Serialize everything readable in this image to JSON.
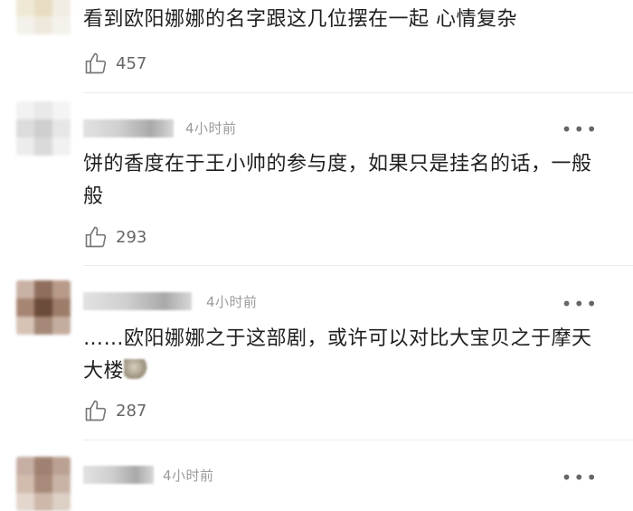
{
  "comments": [
    {
      "text": "看到欧阳娜娜的名字跟这几位摆在一起 心情复杂",
      "likes": "457",
      "time": "",
      "avatar_colors": [
        "#f1eee6",
        "#ece6d6",
        "#f3f0e8",
        "#efe8d4",
        "#e8ddc3",
        "#f2ede2",
        "#f4f1ea",
        "#efe9dd",
        "#f5f2ec"
      ]
    },
    {
      "text": "饼的香度在于王小帅的参与度，如果只是挂名的话，一般般",
      "likes": "293",
      "time": "4小时前",
      "avatar_colors": [
        "#f2f2f2",
        "#e9e9e9",
        "#f4f4f4",
        "#dcdcdc",
        "#cfcfcf",
        "#e6e6e6",
        "#ececec",
        "#dadada",
        "#f1f1f1"
      ]
    },
    {
      "text": "……欧阳娜娜之于这部剧，或许可以对比大宝贝之于摩天大楼",
      "likes": "287",
      "time": "4小时前",
      "avatar_colors": [
        "#c9b2a5",
        "#8f6e5d",
        "#b89a88",
        "#a78573",
        "#6b4b3a",
        "#9d7c6a",
        "#d6c3b6",
        "#a58877",
        "#c4ad9f"
      ]
    },
    {
      "text": "",
      "likes": "",
      "time": "4小时前",
      "avatar_colors": [
        "#c6aea4",
        "#9f8171",
        "#bba193",
        "#d1bcae",
        "#a88a7a",
        "#c9b3a6",
        "#e3d6cc",
        "#cdb8aa",
        "#dccfc4"
      ]
    }
  ],
  "more_label": "•••",
  "ellipsis_icon": "more-dots-icon",
  "like_icon": "thumbs-up-icon"
}
